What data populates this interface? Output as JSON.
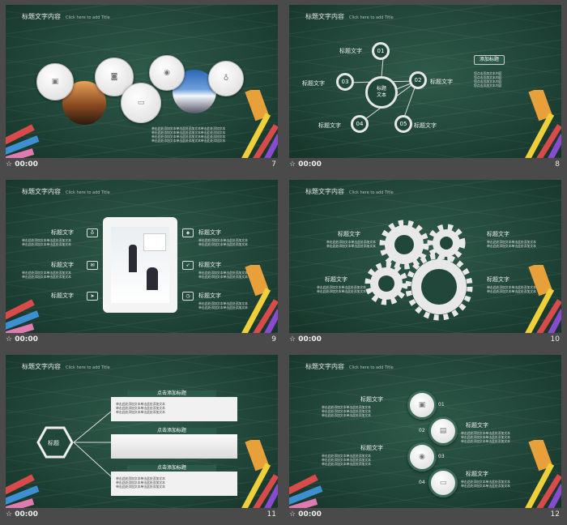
{
  "slides": [
    {
      "number": "7",
      "time": "00:00",
      "title": "标题文字内容",
      "subtitle": "Click here to add Title",
      "body": "单击此处添加文本单击此处添加文本单击此处添加文本"
    },
    {
      "number": "8",
      "time": "00:00",
      "center": "标题\n文本",
      "nodes": [
        "01",
        "02",
        "03",
        "04",
        "05"
      ],
      "labels": [
        "标题文字",
        "标题文字",
        "标题文字",
        "标题文字",
        "标题文字"
      ],
      "button": "添加标题",
      "body": "您点击添加文本内容"
    },
    {
      "number": "9",
      "time": "00:00",
      "title": "标题文字内容",
      "subtitle": "Click here to add Title",
      "labels": [
        "标题文字",
        "标题文字",
        "标题文字",
        "标题文字",
        "标题文字",
        "标题文字"
      ],
      "body": "单击此处添加文本单击此处添加文本"
    },
    {
      "number": "10",
      "time": "00:00",
      "labels": [
        "标题文字",
        "标题文字",
        "标题文字",
        "标题文字"
      ],
      "body": "单击此处添加文本单击此处添加文本"
    },
    {
      "number": "11",
      "time": "00:00",
      "title": "标题文字内容",
      "subtitle": "Click here to add Title",
      "hex": "标题",
      "bars": [
        "点击添加标题",
        "点击添加标题",
        "点击添加标题"
      ],
      "body": "单击此处添加文本单击此处添加文本"
    },
    {
      "number": "12",
      "time": "00:00",
      "title": "标题文字内容",
      "subtitle": "Click here to add Title",
      "labels": [
        "标题文字",
        "标题文字",
        "标题文字",
        "标题文字"
      ],
      "nums": [
        "01",
        "02",
        "03",
        "04"
      ],
      "body": "单击此处添加文本单击此处添加文本"
    }
  ],
  "colors": {
    "board": "#21473a",
    "accent": "#2c5a48"
  }
}
